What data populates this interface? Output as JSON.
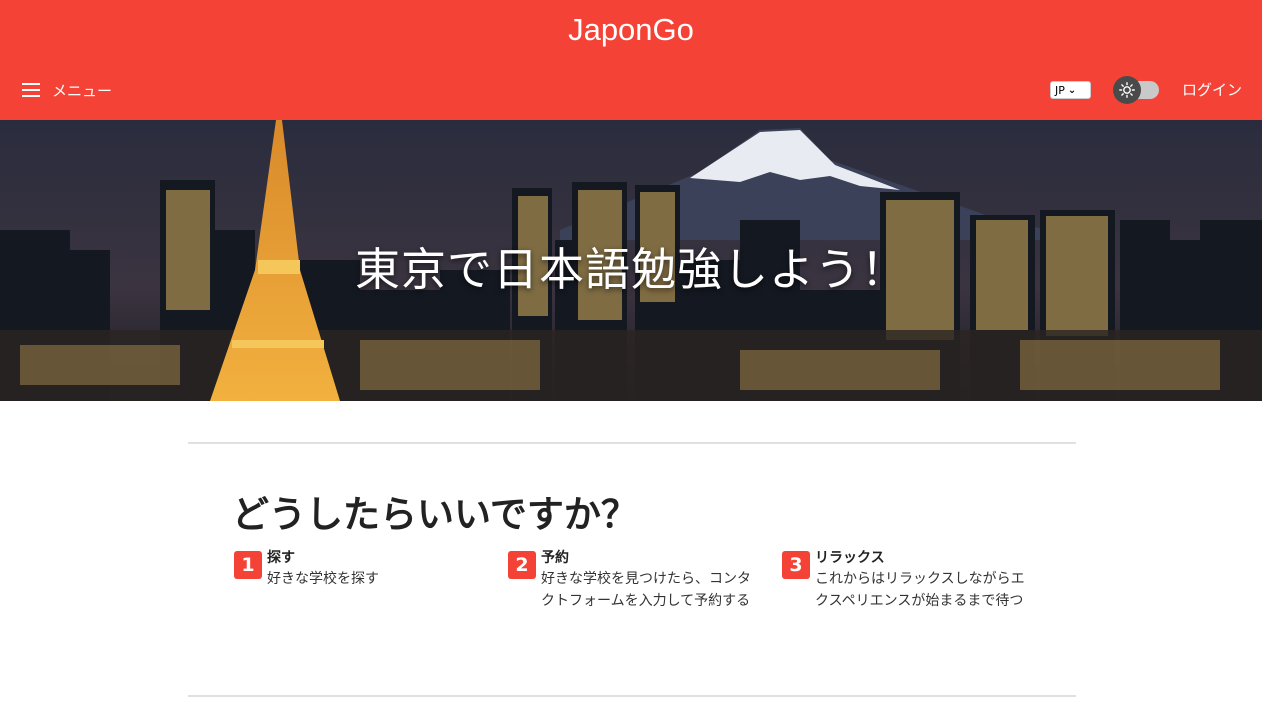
{
  "header": {
    "brand": "JaponGo",
    "menu_label": "メニュー",
    "language": "JP",
    "login_label": "ログイン"
  },
  "hero": {
    "title": "東京で日本語勉強しよう！"
  },
  "how_it_works": {
    "title": "どうしたらいいですか？",
    "steps": [
      {
        "number": "1",
        "title": "探す",
        "description": "好きな学校を探す"
      },
      {
        "number": "2",
        "title": "予約",
        "description": "好きな学校を見つけたら、コンタクトフォームを入力して予約する"
      },
      {
        "number": "3",
        "title": "リラックス",
        "description": "これからはリラックスしながらエクスペリエンスが始まるまで待つ"
      }
    ]
  },
  "colors": {
    "accent": "#f44336",
    "toggle_knob": "#4a4a4a",
    "toggle_track": "#c9c9c9"
  },
  "icons": {
    "menu": "hamburger-icon",
    "theme": "sun-icon",
    "language_dropdown": "chevron-down-icon"
  }
}
